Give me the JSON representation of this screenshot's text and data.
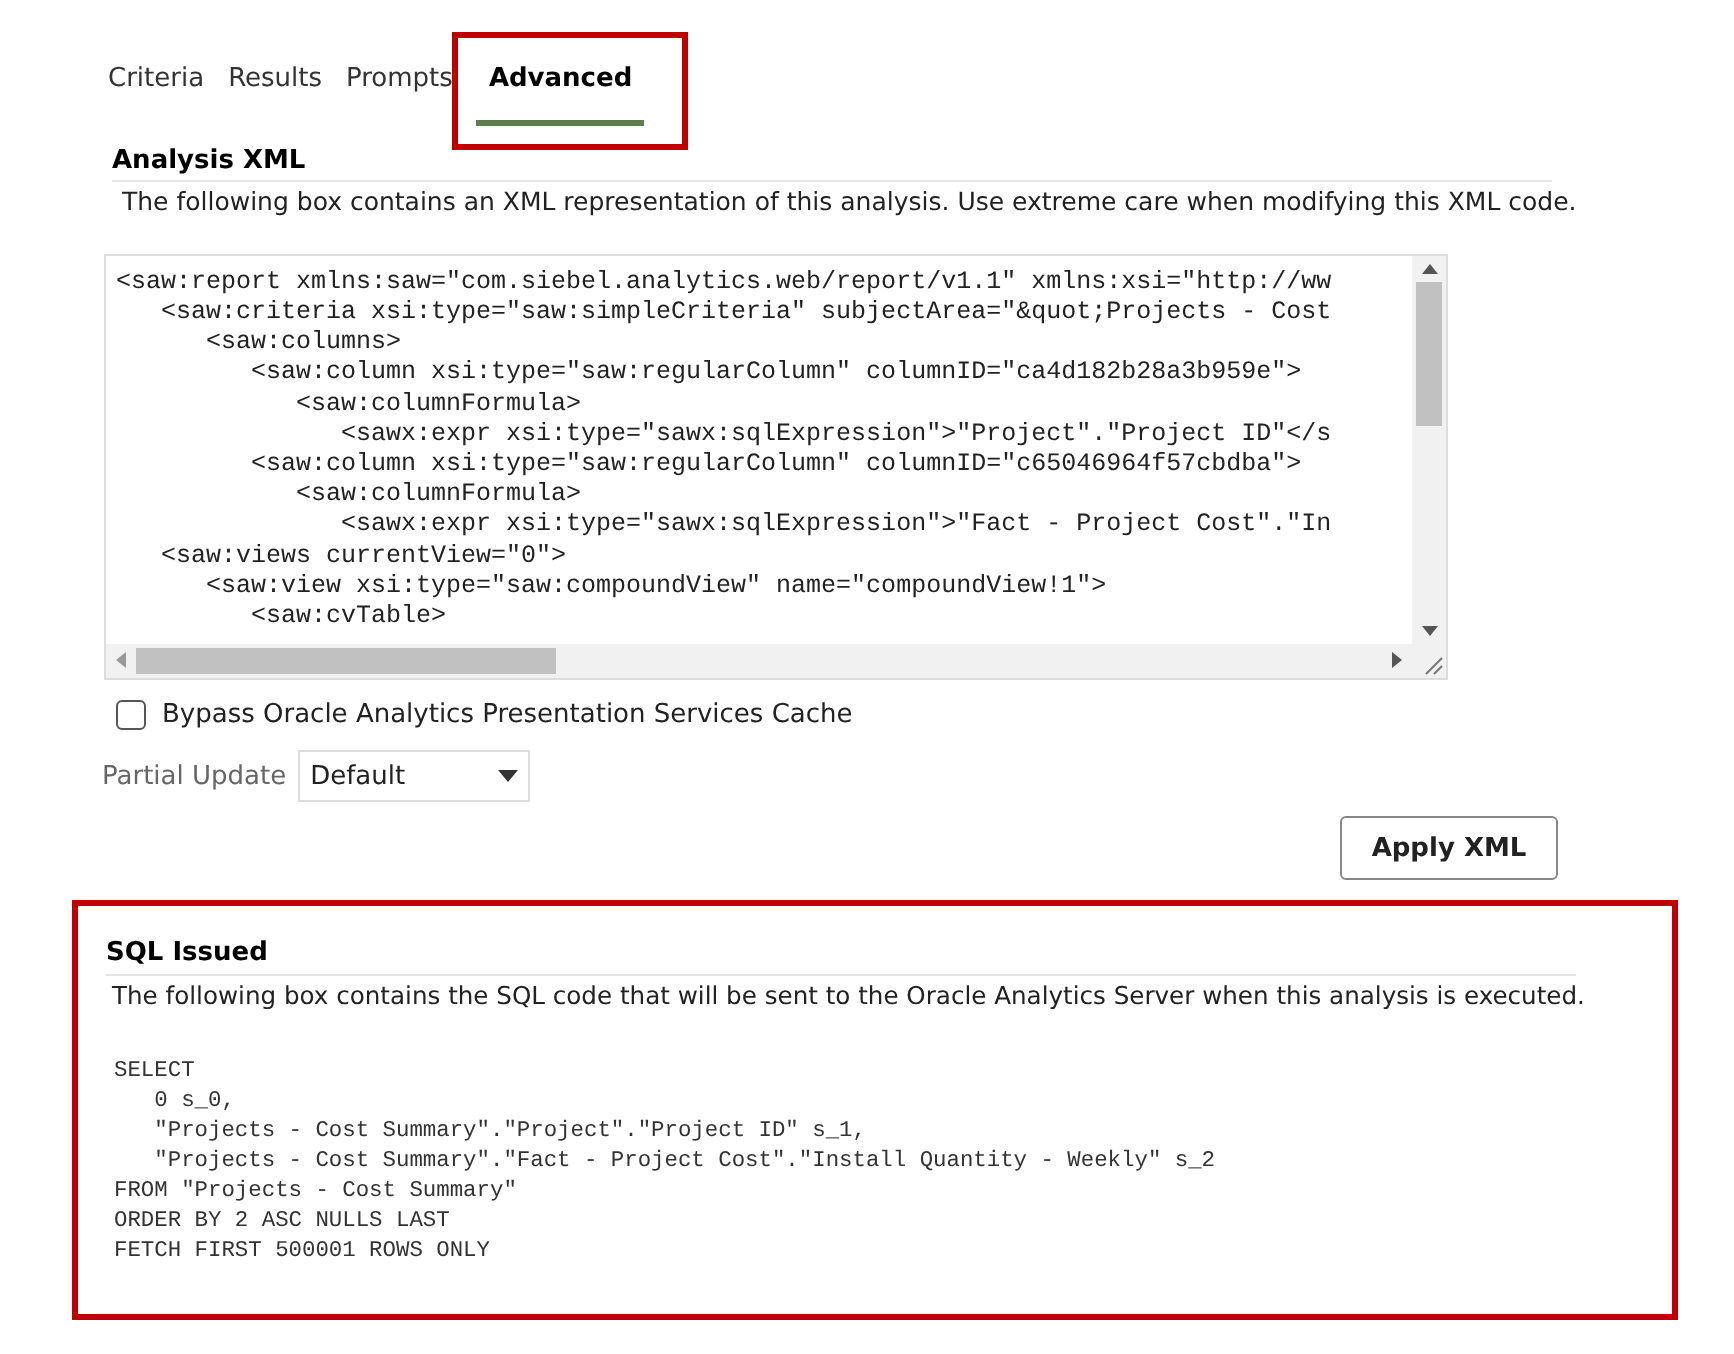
{
  "tabs": [
    {
      "label": "Criteria",
      "selected": false
    },
    {
      "label": "Results",
      "selected": false
    },
    {
      "label": "Prompts",
      "selected": false
    },
    {
      "label": "Advanced",
      "selected": true
    }
  ],
  "analysis_xml": {
    "heading": "Analysis XML",
    "description": "The following box contains an XML representation of this analysis. Use extreme care when modifying this XML code.",
    "code_lines": [
      "<saw:report xmlns:saw=\"com.siebel.analytics.web/report/v1.1\" xmlns:xsi=\"http://ww",
      "   <saw:criteria xsi:type=\"saw:simpleCriteria\" subjectArea=\"&quot;Projects - Cost",
      "      <saw:columns>",
      "         <saw:column xsi:type=\"saw:regularColumn\" columnID=\"ca4d182b28a3b959e\">",
      "            <saw:columnFormula>",
      "               <sawx:expr xsi:type=\"sawx:sqlExpression\">\"Project\".\"Project ID\"</s",
      "         <saw:column xsi:type=\"saw:regularColumn\" columnID=\"c65046964f57cbdba\">",
      "            <saw:columnFormula>",
      "               <sawx:expr xsi:type=\"sawx:sqlExpression\">\"Fact - Project Cost\".\"In",
      "   <saw:views currentView=\"0\">",
      "      <saw:view xsi:type=\"saw:compoundView\" name=\"compoundView!1\">",
      "         <saw:cvTable>"
    ]
  },
  "bypass_cache": {
    "label": "Bypass Oracle Analytics Presentation Services Cache",
    "checked": false
  },
  "partial_update": {
    "label": "Partial Update",
    "value": "Default"
  },
  "apply_button": "Apply XML",
  "sql_issued": {
    "heading": "SQL Issued",
    "description": "The following box contains the SQL code that will be sent to the Oracle Analytics Server when this analysis is executed.",
    "code_lines": [
      "SELECT",
      "   0 s_0,",
      "   \"Projects - Cost Summary\".\"Project\".\"Project ID\" s_1,",
      "   \"Projects - Cost Summary\".\"Fact - Project Cost\".\"Install Quantity - Weekly\" s_2",
      "FROM \"Projects - Cost Summary\"",
      "ORDER BY 2 ASC NULLS LAST",
      "FETCH FIRST 500001 ROWS ONLY"
    ]
  }
}
